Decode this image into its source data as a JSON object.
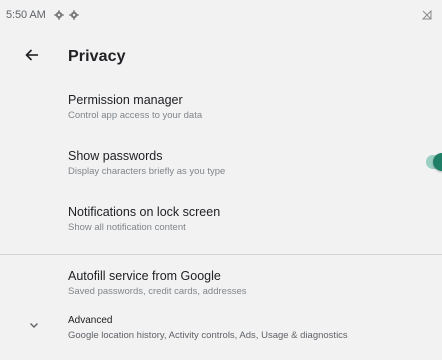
{
  "status_bar": {
    "time": "5:50 AM",
    "icons": [
      "gear-icon",
      "gear-icon",
      "no-signal-icon"
    ]
  },
  "app_bar": {
    "title": "Privacy",
    "back_icon": "arrow-back-icon"
  },
  "items": [
    {
      "title": "Permission manager",
      "subtitle": "Control app access to your data"
    },
    {
      "title": "Show passwords",
      "subtitle": "Display characters briefly as you type",
      "toggle_on": true
    },
    {
      "title": "Notifications on lock screen",
      "subtitle": "Show all notification content"
    },
    {
      "title": "Autofill service from Google",
      "subtitle": "Saved passwords, credit cards, addresses"
    },
    {
      "title": "Advanced",
      "subtitle": "Google location history, Activity controls, Ads, Usage & diagnostics",
      "icon": "chevron-down-icon"
    }
  ],
  "colors": {
    "background": "#f2f2f2",
    "accent": "#1e7f66",
    "accent_track": "#9ccfc3",
    "divider": "#d6d6d6"
  }
}
